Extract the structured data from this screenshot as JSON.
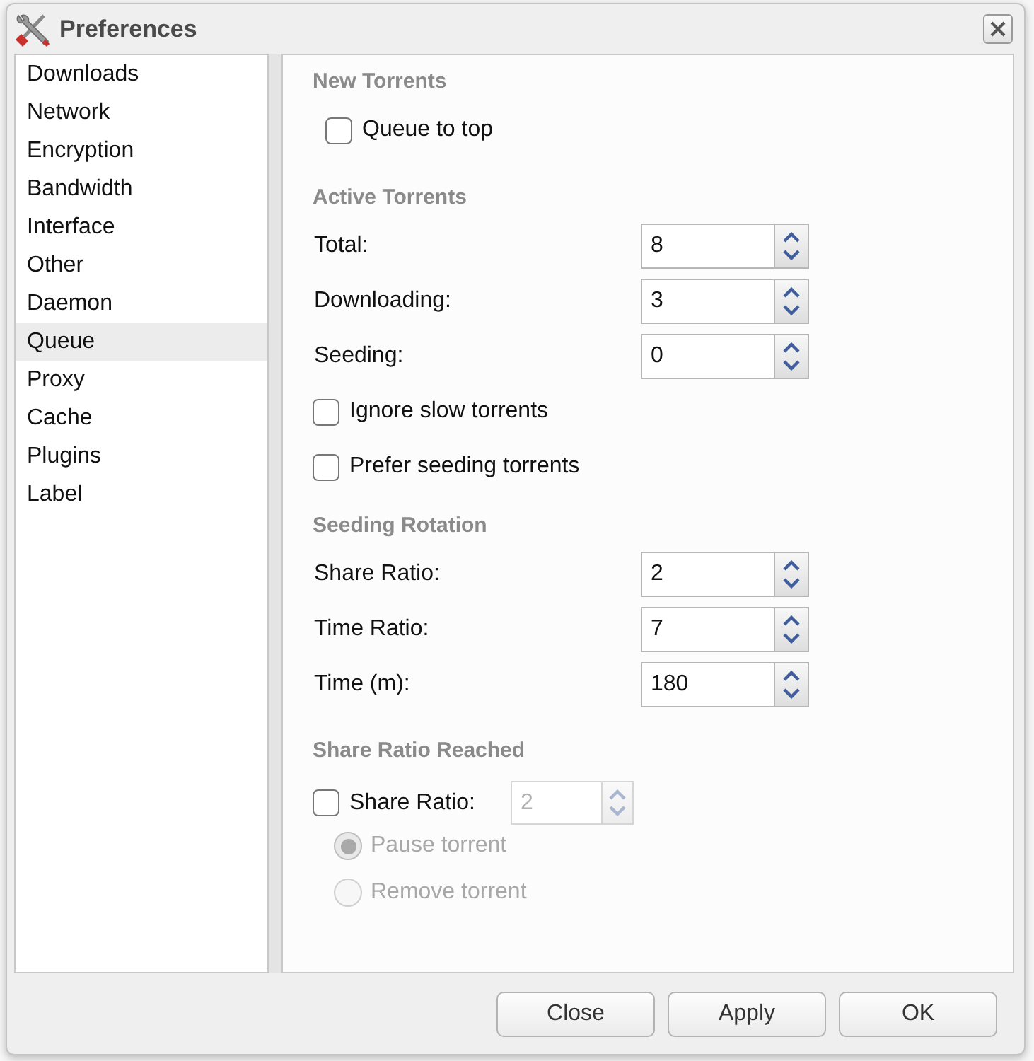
{
  "window": {
    "title": "Preferences"
  },
  "sidebar": {
    "items": [
      {
        "label": "Downloads",
        "selected": false
      },
      {
        "label": "Network",
        "selected": false
      },
      {
        "label": "Encryption",
        "selected": false
      },
      {
        "label": "Bandwidth",
        "selected": false
      },
      {
        "label": "Interface",
        "selected": false
      },
      {
        "label": "Other",
        "selected": false
      },
      {
        "label": "Daemon",
        "selected": false
      },
      {
        "label": "Queue",
        "selected": true
      },
      {
        "label": "Proxy",
        "selected": false
      },
      {
        "label": "Cache",
        "selected": false
      },
      {
        "label": "Plugins",
        "selected": false
      },
      {
        "label": "Label",
        "selected": false
      }
    ]
  },
  "sections": [
    {
      "title": "New Torrents",
      "rows": [
        {
          "kind": "checkbox",
          "label": "Queue to top",
          "checked": false
        }
      ]
    },
    {
      "title": "Active Torrents",
      "rows": [
        {
          "kind": "spinner",
          "label": "Total:",
          "spinner": {
            "value": "8",
            "disabled": false
          }
        },
        {
          "kind": "spinner",
          "label": "Downloading:",
          "spinner": {
            "value": "3",
            "disabled": false
          }
        },
        {
          "kind": "spinner",
          "label": "Seeding:",
          "spinner": {
            "value": "0",
            "disabled": false
          }
        },
        {
          "kind": "checkbox",
          "label": "Ignore slow torrents",
          "checked": false
        },
        {
          "kind": "checkbox",
          "label": "Prefer seeding torrents",
          "checked": false
        }
      ]
    },
    {
      "title": "Seeding Rotation",
      "rows": [
        {
          "kind": "spinner",
          "label": "Share Ratio:",
          "spinner": {
            "value": "2",
            "disabled": false
          }
        },
        {
          "kind": "spinner",
          "label": "Time Ratio:",
          "spinner": {
            "value": "7",
            "disabled": false
          }
        },
        {
          "kind": "spinner",
          "label": "Time (m):",
          "spinner": {
            "value": "180",
            "disabled": false
          }
        }
      ]
    },
    {
      "title": "Share Ratio Reached",
      "rows": [
        {
          "kind": "checkbox-spinner",
          "label": "Share Ratio:",
          "checked": false,
          "spinner": {
            "value": "2",
            "disabled": true
          }
        },
        {
          "kind": "radio",
          "label": "Pause torrent",
          "selected": true,
          "disabled": true
        },
        {
          "kind": "radio",
          "label": "Remove torrent",
          "selected": false,
          "disabled": true
        }
      ]
    }
  ],
  "buttons": [
    {
      "label": "Close"
    },
    {
      "label": "Apply"
    },
    {
      "label": "OK"
    }
  ]
}
